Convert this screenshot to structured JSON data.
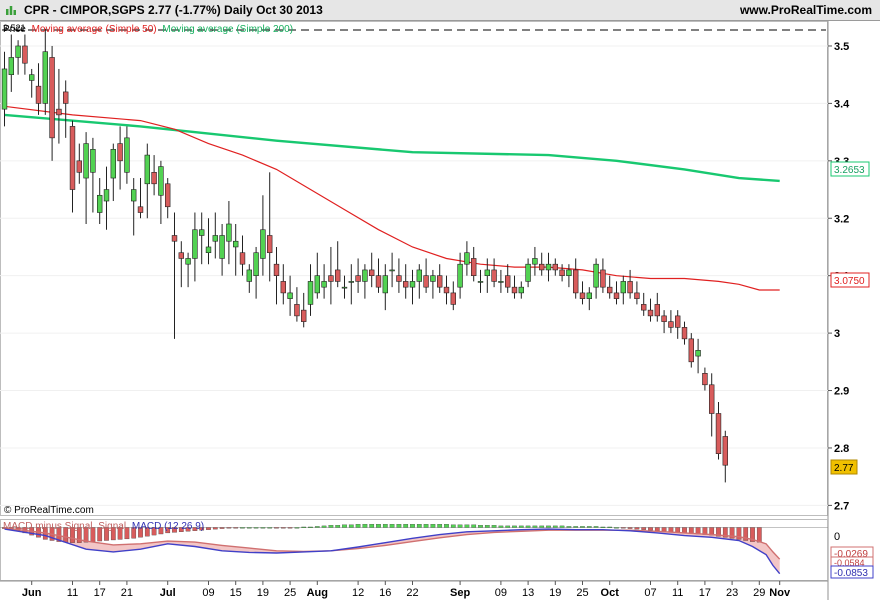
{
  "header": {
    "title": "CPR - CIMPOR,SGPS    2.77 (-1.77%)     Daily  Oct 30 2013",
    "site": "www.ProRealTime.com"
  },
  "price_panel": {
    "legend_price": "Price",
    "legend_ma50": "Moving average (Simple 50)",
    "legend_ma200": "Moving average (Simple 200)",
    "corner_value": "3.521",
    "copyright": "© ProRealTime.com",
    "tag_ma200": "3.2653",
    "tag_ma50": "3.0750",
    "tag_price": "2.77",
    "y_ticks": [
      "3.5",
      "3.4",
      "3.3",
      "3.2",
      "3.1",
      "3",
      "2.9",
      "2.8",
      "2.7"
    ]
  },
  "macd_panel": {
    "legend_hist": "MACD minus Signal",
    "legend_signal": "Signal",
    "legend_macd": "MACD (12 26 9)",
    "tag_zero": "0",
    "tag_hist": "-0.0269",
    "tag_signal": "-0.0584",
    "tag_macd": "-0.0853"
  },
  "x_ticks": [
    "Jun",
    "11",
    "17",
    "21",
    "Jul",
    "09",
    "15",
    "19",
    "25",
    "Aug",
    "12",
    "16",
    "22",
    "Sep",
    "09",
    "13",
    "19",
    "25",
    "Oct",
    "07",
    "11",
    "17",
    "23",
    "29",
    "Nov"
  ],
  "colors": {
    "up": "#52d252",
    "down": "#d85c5c",
    "ma50": "#e02020",
    "ma200": "#18c870",
    "macd": "#4040c8",
    "signal": "#d07070",
    "price_tag": "#f0c000"
  },
  "chart_data": {
    "type": "candlestick",
    "title": "CPR - CIMPOR,SGPS  2.77 (-1.77%)  Daily  Oct 30 2013",
    "ylim": [
      2.685,
      3.54
    ],
    "y_ticks": [
      3.5,
      3.4,
      3.3,
      3.2,
      3.1,
      3.0,
      2.9,
      2.8,
      2.7
    ],
    "x_ticks": [
      {
        "label": "Jun",
        "i": 4
      },
      {
        "label": "11",
        "i": 10
      },
      {
        "label": "17",
        "i": 14
      },
      {
        "label": "21",
        "i": 18
      },
      {
        "label": "Jul",
        "i": 24
      },
      {
        "label": "09",
        "i": 30
      },
      {
        "label": "15",
        "i": 34
      },
      {
        "label": "19",
        "i": 38
      },
      {
        "label": "25",
        "i": 42
      },
      {
        "label": "Aug",
        "i": 46
      },
      {
        "label": "12",
        "i": 52
      },
      {
        "label": "16",
        "i": 56
      },
      {
        "label": "22",
        "i": 60
      },
      {
        "label": "Sep",
        "i": 67
      },
      {
        "label": "09",
        "i": 73
      },
      {
        "label": "13",
        "i": 77
      },
      {
        "label": "19",
        "i": 81
      },
      {
        "label": "25",
        "i": 85
      },
      {
        "label": "Oct",
        "i": 89
      },
      {
        "label": "07",
        "i": 95
      },
      {
        "label": "11",
        "i": 99
      },
      {
        "label": "17",
        "i": 103
      },
      {
        "label": "23",
        "i": 107
      },
      {
        "label": "29",
        "i": 111
      },
      {
        "label": "Nov",
        "i": 114
      }
    ],
    "candles": [
      [
        3.39,
        3.49,
        3.36,
        3.46
      ],
      [
        3.45,
        3.52,
        3.42,
        3.48
      ],
      [
        3.48,
        3.51,
        3.45,
        3.5
      ],
      [
        3.5,
        3.52,
        3.45,
        3.47
      ],
      [
        3.44,
        3.46,
        3.41,
        3.45
      ],
      [
        3.43,
        3.47,
        3.38,
        3.4
      ],
      [
        3.4,
        3.53,
        3.38,
        3.49
      ],
      [
        3.48,
        3.5,
        3.3,
        3.34
      ],
      [
        3.39,
        3.46,
        3.33,
        3.38
      ],
      [
        3.42,
        3.44,
        3.34,
        3.4
      ],
      [
        3.36,
        3.37,
        3.21,
        3.25
      ],
      [
        3.3,
        3.33,
        3.26,
        3.28
      ],
      [
        3.27,
        3.35,
        3.19,
        3.33
      ],
      [
        3.28,
        3.34,
        3.21,
        3.32
      ],
      [
        3.21,
        3.27,
        3.19,
        3.24
      ],
      [
        3.23,
        3.29,
        3.18,
        3.25
      ],
      [
        3.27,
        3.33,
        3.23,
        3.32
      ],
      [
        3.33,
        3.36,
        3.25,
        3.3
      ],
      [
        3.28,
        3.36,
        3.26,
        3.34
      ],
      [
        3.23,
        3.27,
        3.17,
        3.25
      ],
      [
        3.22,
        3.27,
        3.2,
        3.21
      ],
      [
        3.26,
        3.33,
        3.2,
        3.31
      ],
      [
        3.28,
        3.31,
        3.24,
        3.26
      ],
      [
        3.24,
        3.3,
        3.19,
        3.29
      ],
      [
        3.26,
        3.27,
        3.2,
        3.22
      ],
      [
        3.17,
        3.21,
        2.99,
        3.16
      ],
      [
        3.14,
        3.16,
        3.08,
        3.13
      ],
      [
        3.12,
        3.14,
        3.08,
        3.13
      ],
      [
        3.13,
        3.21,
        3.09,
        3.18
      ],
      [
        3.17,
        3.21,
        3.12,
        3.18
      ],
      [
        3.14,
        3.2,
        3.12,
        3.15
      ],
      [
        3.16,
        3.21,
        3.13,
        3.17
      ],
      [
        3.13,
        3.19,
        3.1,
        3.17
      ],
      [
        3.16,
        3.23,
        3.12,
        3.19
      ],
      [
        3.15,
        3.19,
        3.1,
        3.16
      ],
      [
        3.14,
        3.17,
        3.1,
        3.12
      ],
      [
        3.09,
        3.12,
        3.07,
        3.11
      ],
      [
        3.1,
        3.15,
        3.06,
        3.14
      ],
      [
        3.13,
        3.24,
        3.1,
        3.18
      ],
      [
        3.17,
        3.28,
        3.09,
        3.14
      ],
      [
        3.12,
        3.15,
        3.05,
        3.1
      ],
      [
        3.09,
        3.12,
        3.05,
        3.07
      ],
      [
        3.06,
        3.1,
        3.03,
        3.07
      ],
      [
        3.05,
        3.08,
        3.02,
        3.03
      ],
      [
        3.04,
        3.07,
        3.01,
        3.02
      ],
      [
        3.05,
        3.12,
        3.03,
        3.09
      ],
      [
        3.07,
        3.14,
        3.06,
        3.1
      ],
      [
        3.08,
        3.12,
        3.06,
        3.09
      ],
      [
        3.1,
        3.15,
        3.05,
        3.09
      ],
      [
        3.11,
        3.16,
        3.08,
        3.09
      ],
      [
        3.08,
        3.1,
        3.06,
        3.08
      ],
      [
        3.09,
        3.12,
        3.05,
        3.09
      ],
      [
        3.1,
        3.13,
        3.07,
        3.09
      ],
      [
        3.09,
        3.12,
        3.06,
        3.11
      ],
      [
        3.11,
        3.14,
        3.08,
        3.1
      ],
      [
        3.1,
        3.13,
        3.07,
        3.08
      ],
      [
        3.07,
        3.12,
        3.04,
        3.1
      ],
      [
        3.11,
        3.14,
        3.08,
        3.11
      ],
      [
        3.1,
        3.13,
        3.07,
        3.09
      ],
      [
        3.09,
        3.12,
        3.06,
        3.08
      ],
      [
        3.08,
        3.11,
        3.05,
        3.09
      ],
      [
        3.09,
        3.12,
        3.06,
        3.11
      ],
      [
        3.1,
        3.13,
        3.07,
        3.08
      ],
      [
        3.09,
        3.11,
        3.06,
        3.1
      ],
      [
        3.1,
        3.12,
        3.07,
        3.08
      ],
      [
        3.08,
        3.1,
        3.05,
        3.07
      ],
      [
        3.07,
        3.09,
        3.04,
        3.05
      ],
      [
        3.08,
        3.14,
        3.06,
        3.12
      ],
      [
        3.12,
        3.16,
        3.1,
        3.14
      ],
      [
        3.13,
        3.15,
        3.09,
        3.1
      ],
      [
        3.09,
        3.11,
        3.07,
        3.09
      ],
      [
        3.1,
        3.13,
        3.07,
        3.11
      ],
      [
        3.11,
        3.13,
        3.08,
        3.09
      ],
      [
        3.09,
        3.11,
        3.07,
        3.09
      ],
      [
        3.1,
        3.12,
        3.07,
        3.08
      ],
      [
        3.08,
        3.1,
        3.06,
        3.07
      ],
      [
        3.07,
        3.09,
        3.06,
        3.08
      ],
      [
        3.09,
        3.13,
        3.08,
        3.12
      ],
      [
        3.12,
        3.15,
        3.1,
        3.13
      ],
      [
        3.12,
        3.14,
        3.1,
        3.11
      ],
      [
        3.11,
        3.14,
        3.09,
        3.12
      ],
      [
        3.12,
        3.13,
        3.1,
        3.11
      ],
      [
        3.11,
        3.12,
        3.09,
        3.1
      ],
      [
        3.1,
        3.12,
        3.08,
        3.11
      ],
      [
        3.11,
        3.13,
        3.06,
        3.07
      ],
      [
        3.07,
        3.09,
        3.05,
        3.06
      ],
      [
        3.06,
        3.08,
        3.04,
        3.07
      ],
      [
        3.08,
        3.13,
        3.06,
        3.12
      ],
      [
        3.11,
        3.13,
        3.07,
        3.08
      ],
      [
        3.08,
        3.1,
        3.06,
        3.07
      ],
      [
        3.07,
        3.09,
        3.05,
        3.06
      ],
      [
        3.07,
        3.1,
        3.05,
        3.09
      ],
      [
        3.09,
        3.11,
        3.06,
        3.07
      ],
      [
        3.07,
        3.09,
        3.05,
        3.06
      ],
      [
        3.05,
        3.07,
        3.03,
        3.04
      ],
      [
        3.04,
        3.06,
        3.02,
        3.03
      ],
      [
        3.05,
        3.07,
        3.02,
        3.03
      ],
      [
        3.03,
        3.04,
        3.0,
        3.02
      ],
      [
        3.02,
        3.04,
        3.0,
        3.01
      ],
      [
        3.03,
        3.04,
        2.99,
        3.01
      ],
      [
        3.01,
        3.02,
        2.98,
        2.99
      ],
      [
        2.99,
        3.0,
        2.94,
        2.95
      ],
      [
        2.96,
        2.99,
        2.93,
        2.97
      ],
      [
        2.93,
        2.94,
        2.9,
        2.91
      ],
      [
        2.91,
        2.93,
        2.82,
        2.86
      ],
      [
        2.86,
        2.88,
        2.78,
        2.79
      ],
      [
        2.82,
        2.83,
        2.74,
        2.77
      ]
    ],
    "ma50": [
      [
        0,
        3.395
      ],
      [
        10,
        3.38
      ],
      [
        20,
        3.37
      ],
      [
        25,
        3.355
      ],
      [
        30,
        3.33
      ],
      [
        35,
        3.31
      ],
      [
        40,
        3.285
      ],
      [
        45,
        3.25
      ],
      [
        50,
        3.215
      ],
      [
        55,
        3.18
      ],
      [
        60,
        3.15
      ],
      [
        65,
        3.13
      ],
      [
        70,
        3.12
      ],
      [
        75,
        3.115
      ],
      [
        80,
        3.115
      ],
      [
        85,
        3.11
      ],
      [
        90,
        3.1
      ],
      [
        95,
        3.095
      ],
      [
        100,
        3.095
      ],
      [
        105,
        3.09
      ],
      [
        108,
        3.085
      ],
      [
        111,
        3.075
      ],
      [
        114,
        3.075
      ]
    ],
    "ma200": [
      [
        0,
        3.38
      ],
      [
        20,
        3.36
      ],
      [
        40,
        3.335
      ],
      [
        60,
        3.315
      ],
      [
        80,
        3.31
      ],
      [
        90,
        3.3
      ],
      [
        100,
        3.285
      ],
      [
        108,
        3.27
      ],
      [
        114,
        3.265
      ]
    ],
    "macd": {
      "ylim": [
        -0.095,
        0.012
      ],
      "histogram": [
        -0.002,
        -0.004,
        -0.006,
        -0.01,
        -0.014,
        -0.018,
        -0.022,
        -0.024,
        -0.026,
        -0.027,
        -0.028,
        -0.028,
        -0.027,
        -0.026,
        -0.025,
        -0.024,
        -0.023,
        -0.022,
        -0.021,
        -0.02,
        -0.018,
        -0.016,
        -0.014,
        -0.012,
        -0.01,
        -0.009,
        -0.008,
        -0.007,
        -0.006,
        -0.005,
        -0.004,
        -0.003,
        -0.002,
        -0.001,
        -0.001,
        0,
        0,
        0,
        0,
        0,
        -0.001,
        -0.001,
        -0.001,
        0,
        0.001,
        0.001,
        0.002,
        0.003,
        0.004,
        0.004,
        0.005,
        0.005,
        0.006,
        0.006,
        0.006,
        0.006,
        0.006,
        0.006,
        0.006,
        0.006,
        0.006,
        0.006,
        0.006,
        0.006,
        0.006,
        0.006,
        0.005,
        0.005,
        0.005,
        0.005,
        0.004,
        0.004,
        0.004,
        0.003,
        0.003,
        0.003,
        0.003,
        0.003,
        0.003,
        0.003,
        0.003,
        0.003,
        0.003,
        0.002,
        0.002,
        0.002,
        0.002,
        0.002,
        0.001,
        0.001,
        0,
        -0.001,
        -0.002,
        -0.003,
        -0.004,
        -0.005,
        -0.006,
        -0.007,
        -0.008,
        -0.009,
        -0.01,
        -0.011,
        -0.012,
        -0.013,
        -0.014,
        -0.016,
        -0.018,
        -0.02,
        -0.022,
        -0.024,
        -0.026,
        -0.027
      ],
      "macd_line": [
        [
          0,
          -0.003
        ],
        [
          6,
          -0.015
        ],
        [
          12,
          -0.04
        ],
        [
          16,
          -0.045
        ],
        [
          20,
          -0.04
        ],
        [
          24,
          -0.03
        ],
        [
          28,
          -0.035
        ],
        [
          32,
          -0.043
        ],
        [
          36,
          -0.046
        ],
        [
          40,
          -0.047
        ],
        [
          44,
          -0.045
        ],
        [
          48,
          -0.043
        ],
        [
          52,
          -0.036
        ],
        [
          56,
          -0.028
        ],
        [
          60,
          -0.02
        ],
        [
          64,
          -0.013
        ],
        [
          68,
          -0.008
        ],
        [
          72,
          -0.006
        ],
        [
          76,
          -0.004
        ],
        [
          80,
          -0.003
        ],
        [
          84,
          -0.004
        ],
        [
          88,
          -0.004
        ],
        [
          92,
          -0.006
        ],
        [
          96,
          -0.01
        ],
        [
          100,
          -0.015
        ],
        [
          104,
          -0.018
        ],
        [
          108,
          -0.024
        ],
        [
          110,
          -0.035
        ],
        [
          112,
          -0.05
        ],
        [
          113,
          -0.07
        ],
        [
          114,
          -0.0853
        ]
      ],
      "signal_line": [
        [
          0,
          -0.001
        ],
        [
          6,
          -0.01
        ],
        [
          12,
          -0.025
        ],
        [
          16,
          -0.032
        ],
        [
          20,
          -0.03
        ],
        [
          24,
          -0.025
        ],
        [
          28,
          -0.027
        ],
        [
          32,
          -0.033
        ],
        [
          36,
          -0.038
        ],
        [
          40,
          -0.043
        ],
        [
          44,
          -0.044
        ],
        [
          48,
          -0.043
        ],
        [
          52,
          -0.039
        ],
        [
          56,
          -0.033
        ],
        [
          60,
          -0.026
        ],
        [
          64,
          -0.019
        ],
        [
          68,
          -0.013
        ],
        [
          72,
          -0.009
        ],
        [
          76,
          -0.007
        ],
        [
          80,
          -0.005
        ],
        [
          84,
          -0.005
        ],
        [
          88,
          -0.005
        ],
        [
          92,
          -0.005
        ],
        [
          96,
          -0.007
        ],
        [
          100,
          -0.01
        ],
        [
          104,
          -0.013
        ],
        [
          108,
          -0.017
        ],
        [
          110,
          -0.022
        ],
        [
          112,
          -0.03
        ],
        [
          113,
          -0.045
        ],
        [
          114,
          -0.0584
        ]
      ]
    }
  }
}
